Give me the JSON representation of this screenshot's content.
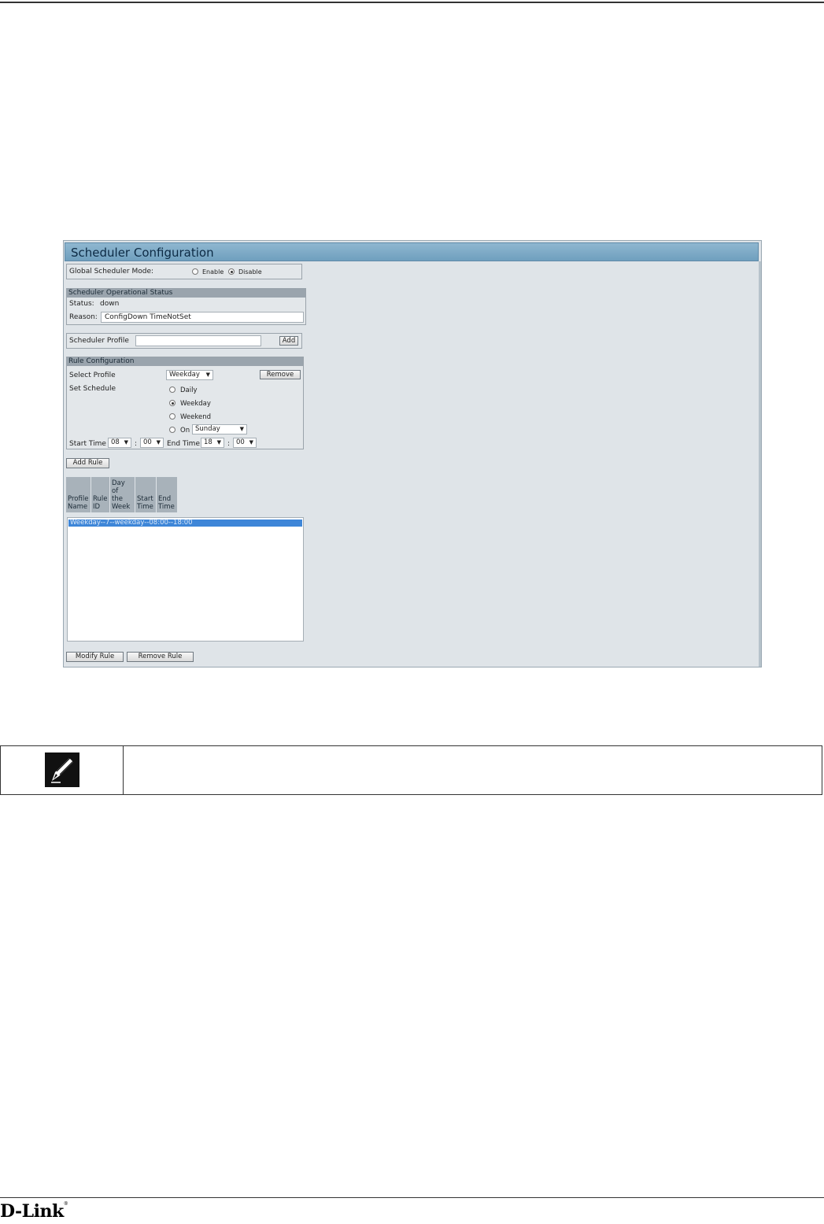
{
  "panel": {
    "title": "Scheduler Configuration",
    "global_mode": {
      "label": "Global Scheduler Mode:",
      "options": [
        {
          "label": "Enable",
          "selected": false
        },
        {
          "label": "Disable",
          "selected": true
        }
      ]
    },
    "operational_status": {
      "header": "Scheduler Operational Status",
      "status_label": "Status:",
      "status_value": "down",
      "reason_label": "Reason:",
      "reason_value": "ConfigDown  TimeNotSet"
    },
    "scheduler_profile": {
      "label": "Scheduler Profile",
      "value": "",
      "add_label": "Add"
    },
    "rule_configuration": {
      "header": "Rule Configuration",
      "select_profile_label": "Select Profile",
      "select_profile_value": "Weekday",
      "remove_label": "Remove",
      "set_schedule_label": "Set Schedule",
      "schedule_options": [
        {
          "label": "Daily",
          "selected": false
        },
        {
          "label": "Weekday",
          "selected": true
        },
        {
          "label": "Weekend",
          "selected": false
        },
        {
          "label": "On",
          "selected": false
        }
      ],
      "on_day_value": "Sunday",
      "start_time_label": "Start Time",
      "start_hour": "08",
      "start_minute": "00",
      "end_time_label": "End Time",
      "end_hour": "18",
      "end_minute": "00",
      "colon": ":"
    },
    "add_rule_label": "Add Rule",
    "rules_table": {
      "headers": [
        "Profile Name",
        "Rule ID",
        "Day of the Week",
        "Start Time",
        "End Time"
      ],
      "header_lines": [
        [
          "Profile",
          "Name"
        ],
        [
          "Rule",
          "ID"
        ],
        [
          "Day",
          "of",
          "the",
          "Week"
        ],
        [
          "Start",
          "Time"
        ],
        [
          "End",
          "Time"
        ]
      ],
      "rows": [
        "Weekday--7--weekday--08:00--18:00"
      ]
    },
    "modify_rule_label": "Modify Rule",
    "remove_rule_label": "Remove Rule"
  },
  "footer": {
    "brand": "D-Link",
    "trademark": "®"
  },
  "icons": {
    "note": "note-pencil-icon",
    "dropdown": "chevron-down-icon"
  }
}
